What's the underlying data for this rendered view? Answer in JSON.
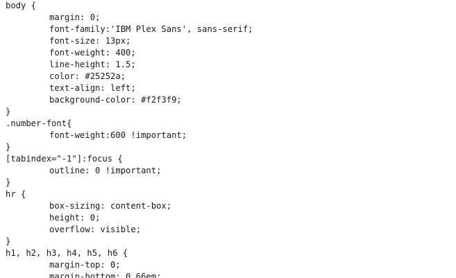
{
  "code_lines": [
    {
      "text": "body {",
      "indent": 0
    },
    {
      "text": "margin: 0;",
      "indent": 1
    },
    {
      "text": "font-family:'IBM Plex Sans', sans-serif;",
      "indent": 1
    },
    {
      "text": "font-size: 13px;",
      "indent": 1
    },
    {
      "text": "font-weight: 400;",
      "indent": 1
    },
    {
      "text": "line-height: 1.5;",
      "indent": 1
    },
    {
      "text": "color: #25252a;",
      "indent": 1
    },
    {
      "text": "text-align: left;",
      "indent": 1
    },
    {
      "text": "background-color: #f2f3f9;",
      "indent": 1
    },
    {
      "text": "}",
      "indent": 0
    },
    {
      "text": ".number-font{",
      "indent": 0
    },
    {
      "text": "font-weight:600 !important;",
      "indent": 1
    },
    {
      "text": "}",
      "indent": 0
    },
    {
      "text": "[tabindex=\"-1\"]:focus {",
      "indent": 0
    },
    {
      "text": "outline: 0 !important;",
      "indent": 1
    },
    {
      "text": "}",
      "indent": 0
    },
    {
      "text": "hr {",
      "indent": 0
    },
    {
      "text": "box-sizing: content-box;",
      "indent": 1
    },
    {
      "text": "height: 0;",
      "indent": 1
    },
    {
      "text": "overflow: visible;",
      "indent": 1
    },
    {
      "text": "}",
      "indent": 0
    },
    {
      "text": "h1, h2, h3, h4, h5, h6 {",
      "indent": 0
    },
    {
      "text": "margin-top: 0;",
      "indent": 1
    },
    {
      "text": "margin-bottom: 0.66em;",
      "indent": 1
    }
  ]
}
